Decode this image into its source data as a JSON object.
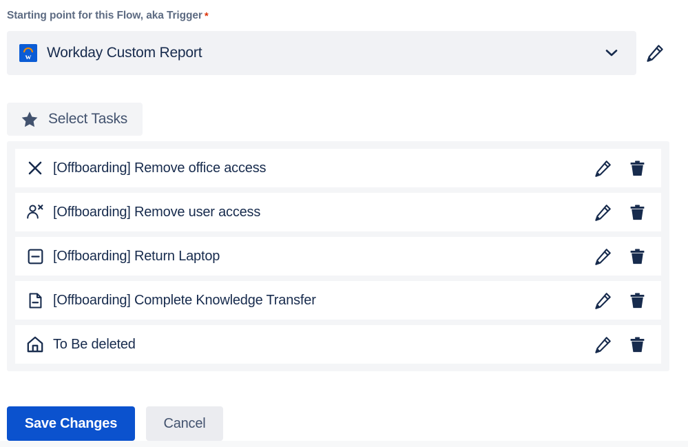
{
  "trigger": {
    "label": "Starting point for this Flow, aka Trigger",
    "required_marker": "*",
    "selected_value": "Workday Custom Report",
    "logo_letter": "w",
    "logo_name": "workday-logo",
    "chevron_icon": "chevron-down-icon",
    "edit_icon": "pencil-icon"
  },
  "select_tasks": {
    "label": "Select Tasks",
    "icon": "star-icon"
  },
  "tasks": [
    {
      "name": "[Offboarding] Remove office access",
      "icon": "close-x-icon",
      "edit_icon": "pencil-icon",
      "delete_icon": "trash-icon"
    },
    {
      "name": "[Offboarding] Remove user access",
      "icon": "user-remove-icon",
      "edit_icon": "pencil-icon",
      "delete_icon": "trash-icon"
    },
    {
      "name": "[Offboarding] Return Laptop",
      "icon": "square-minus-icon",
      "edit_icon": "pencil-icon",
      "delete_icon": "trash-icon"
    },
    {
      "name": "[Offboarding] Complete Knowledge Transfer",
      "icon": "file-minus-icon",
      "edit_icon": "pencil-icon",
      "delete_icon": "trash-icon"
    },
    {
      "name": "To Be deleted",
      "icon": "home-icon",
      "edit_icon": "pencil-icon",
      "delete_icon": "trash-icon"
    }
  ],
  "footer": {
    "save_label": "Save Changes",
    "cancel_label": "Cancel"
  },
  "colors": {
    "primary_blue": "#0b52ce",
    "icon_navy": "#172b4d",
    "label_slate": "#5d6b82",
    "required_red": "#de350b",
    "list_bg": "#f4f5f7",
    "field_bg": "#f1f2f5",
    "workday_blue": "#0b5cd5",
    "workday_orange": "#f38b00"
  }
}
